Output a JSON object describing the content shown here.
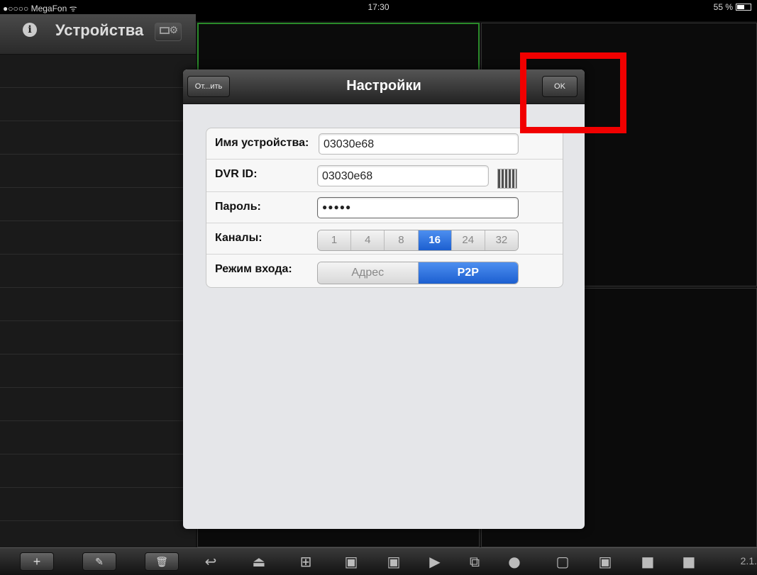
{
  "status_bar": {
    "carrier": "●○○○○ MegaFon ᯤ",
    "time": "17:30",
    "battery": "55 %"
  },
  "sidebar": {
    "title": "Устройства",
    "info_icon": "i",
    "row_count": 15
  },
  "dialog": {
    "cancel_label": "От...ить",
    "title": "Настройки",
    "ok_label": "OK",
    "fields": {
      "device_name": {
        "label": "Имя устройства:",
        "value": "03030e68"
      },
      "dvr_id": {
        "label": "DVR ID:",
        "value": "03030e68"
      },
      "password": {
        "label": "Пароль:",
        "value": "●●●●●"
      },
      "channels": {
        "label": "Каналы:",
        "options": [
          "1",
          "4",
          "8",
          "16",
          "24",
          "32"
        ],
        "selected": "16"
      },
      "login_mode": {
        "label": "Режим входа:",
        "options": [
          "Адрес",
          "P2P"
        ],
        "selected": "P2P"
      }
    }
  },
  "toolbar": {
    "add_label": "+",
    "version": "2.1."
  },
  "colors": {
    "accent": "#1c5fd0",
    "highlight": "#f10000",
    "active_cell": "#2a8a2a"
  }
}
